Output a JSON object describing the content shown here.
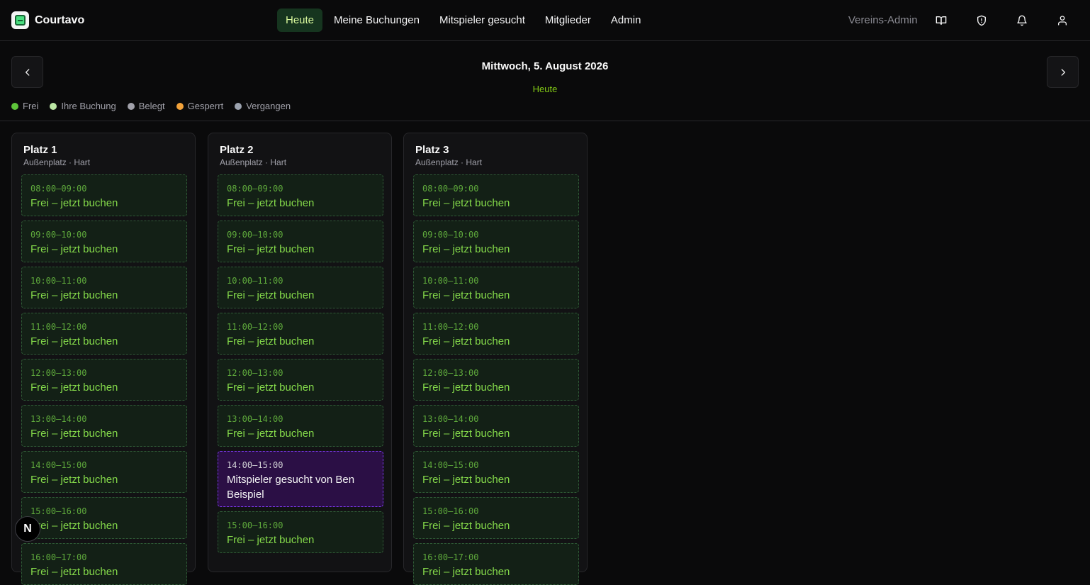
{
  "app": {
    "name": "Courtavo"
  },
  "nav": [
    {
      "label": "Heute",
      "active": true
    },
    {
      "label": "Meine Buchungen",
      "active": false
    },
    {
      "label": "Mitspieler gesucht",
      "active": false
    },
    {
      "label": "Mitglieder",
      "active": false
    },
    {
      "label": "Admin",
      "active": false
    }
  ],
  "header": {
    "role_label": "Vereins-Admin",
    "icons": [
      "book-icon",
      "shield-icon",
      "bell-icon",
      "user-icon"
    ]
  },
  "datebar": {
    "date": "Mittwoch, 5. August 2026",
    "today_label": "Heute"
  },
  "legend": [
    {
      "label": "Frei",
      "color": "#5ec53a"
    },
    {
      "label": "Ihre Buchung",
      "color": "#bbe6a4"
    },
    {
      "label": "Belegt",
      "color": "#a1a1aa"
    },
    {
      "label": "Gesperrt",
      "color": "#f2a23a"
    },
    {
      "label": "Vergangen",
      "color": "#9ca3af"
    }
  ],
  "courts": [
    {
      "name": "Platz 1",
      "subtitle": "Außenplatz · Hart",
      "slots": [
        {
          "time": "08:00–09:00",
          "label": "Frei – jetzt buchen",
          "type": "free"
        },
        {
          "time": "09:00–10:00",
          "label": "Frei – jetzt buchen",
          "type": "free"
        },
        {
          "time": "10:00–11:00",
          "label": "Frei – jetzt buchen",
          "type": "free"
        },
        {
          "time": "11:00–12:00",
          "label": "Frei – jetzt buchen",
          "type": "free"
        },
        {
          "time": "12:00–13:00",
          "label": "Frei – jetzt buchen",
          "type": "free"
        },
        {
          "time": "13:00–14:00",
          "label": "Frei – jetzt buchen",
          "type": "free"
        },
        {
          "time": "14:00–15:00",
          "label": "Frei – jetzt buchen",
          "type": "free"
        },
        {
          "time": "15:00–16:00",
          "label": "Frei – jetzt buchen",
          "type": "free"
        },
        {
          "time": "16:00–17:00",
          "label": "Frei – jetzt buchen",
          "type": "free"
        }
      ]
    },
    {
      "name": "Platz 2",
      "subtitle": "Außenplatz · Hart",
      "slots": [
        {
          "time": "08:00–09:00",
          "label": "Frei – jetzt buchen",
          "type": "free"
        },
        {
          "time": "09:00–10:00",
          "label": "Frei – jetzt buchen",
          "type": "free"
        },
        {
          "time": "10:00–11:00",
          "label": "Frei – jetzt buchen",
          "type": "free"
        },
        {
          "time": "11:00–12:00",
          "label": "Frei – jetzt buchen",
          "type": "free"
        },
        {
          "time": "12:00–13:00",
          "label": "Frei – jetzt buchen",
          "type": "free"
        },
        {
          "time": "13:00–14:00",
          "label": "Frei – jetzt buchen",
          "type": "free"
        },
        {
          "time": "14:00–15:00",
          "label": "Mitspieler gesucht von Ben Beispiel",
          "type": "mate"
        },
        {
          "time": "15:00–16:00",
          "label": "Frei – jetzt buchen",
          "type": "free"
        }
      ]
    },
    {
      "name": "Platz 3",
      "subtitle": "Außenplatz · Hart",
      "slots": [
        {
          "time": "08:00–09:00",
          "label": "Frei – jetzt buchen",
          "type": "free"
        },
        {
          "time": "09:00–10:00",
          "label": "Frei – jetzt buchen",
          "type": "free"
        },
        {
          "time": "10:00–11:00",
          "label": "Frei – jetzt buchen",
          "type": "free"
        },
        {
          "time": "11:00–12:00",
          "label": "Frei – jetzt buchen",
          "type": "free"
        },
        {
          "time": "12:00–13:00",
          "label": "Frei – jetzt buchen",
          "type": "free"
        },
        {
          "time": "13:00–14:00",
          "label": "Frei – jetzt buchen",
          "type": "free"
        },
        {
          "time": "14:00–15:00",
          "label": "Frei – jetzt buchen",
          "type": "free"
        },
        {
          "time": "15:00–16:00",
          "label": "Frei – jetzt buchen",
          "type": "free"
        },
        {
          "time": "16:00–17:00",
          "label": "Frei – jetzt buchen",
          "type": "free"
        }
      ]
    }
  ],
  "dev_badge": {
    "letter": "N"
  }
}
